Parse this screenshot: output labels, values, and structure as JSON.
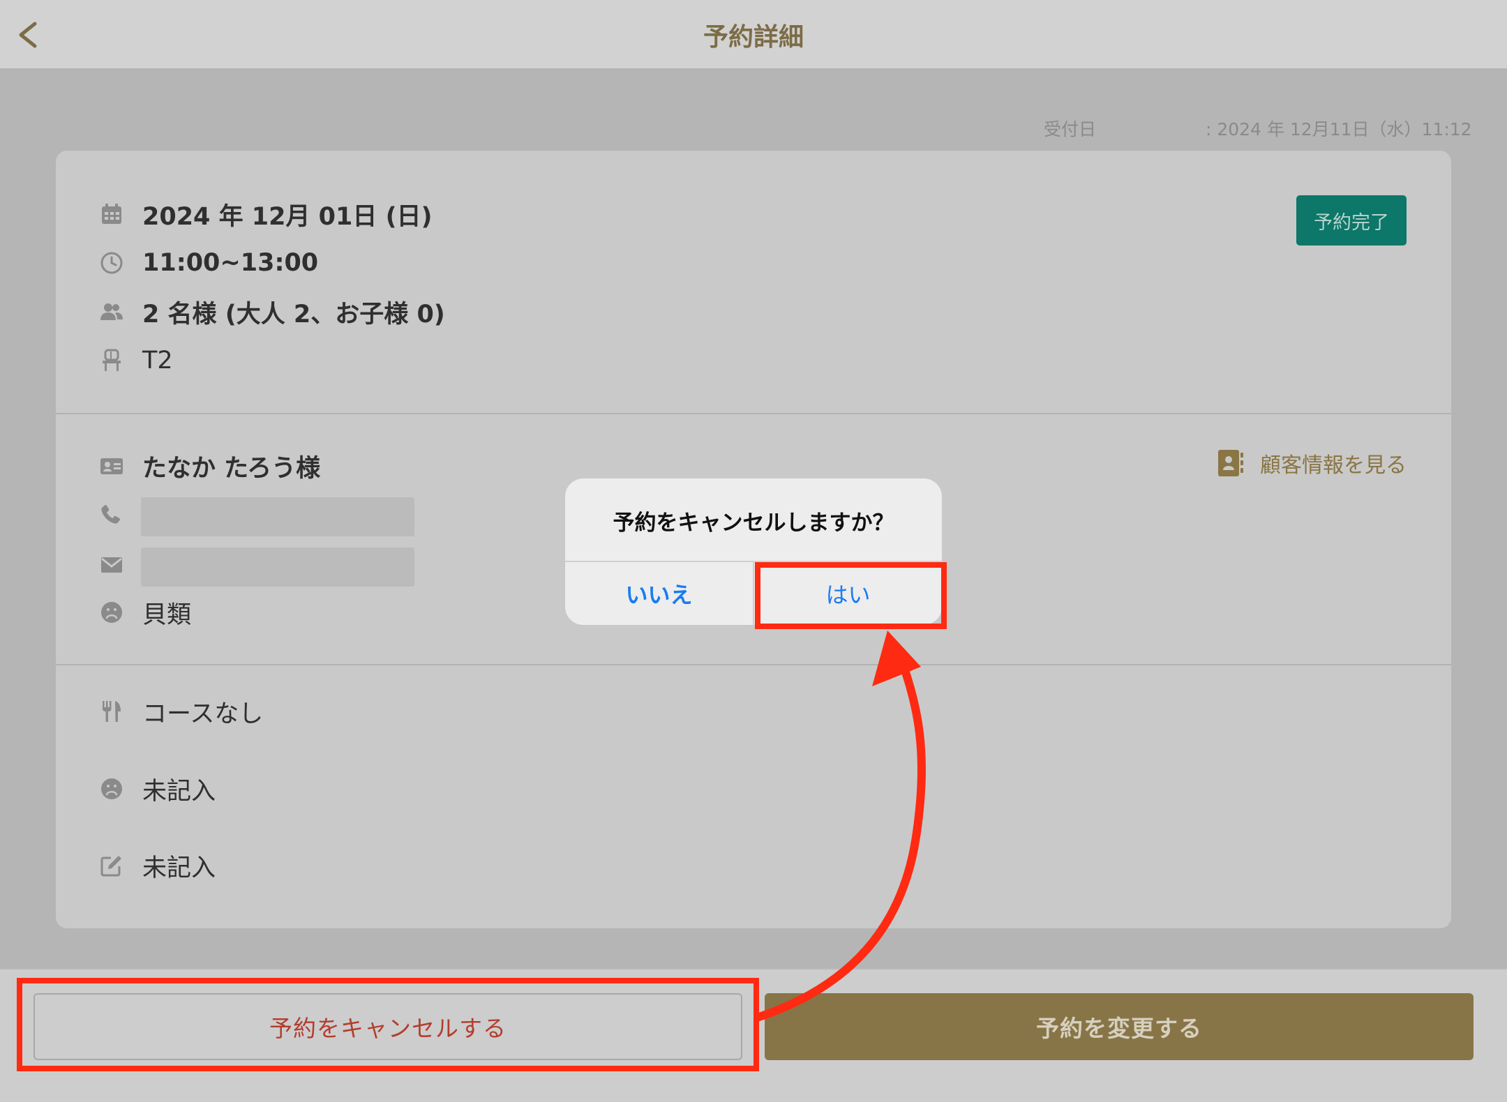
{
  "header": {
    "title": "予約詳細"
  },
  "received": {
    "label": "受付日",
    "value": ": 2024 年 12月11日（水）11:12"
  },
  "reservation": {
    "date": "2024 年 12月 01日 (日)",
    "time": "11:00~13:00",
    "guests": "2 名様 (大人 2、お子様 0)",
    "table": "T2",
    "status": "予約完了"
  },
  "customer": {
    "name": "たなか たろう様",
    "view_link": "顧客情報を見る",
    "allergy": "貝類"
  },
  "details": {
    "course": "コースなし",
    "note1": "未記入",
    "note2": "未記入"
  },
  "footer": {
    "cancel_label": "予約をキャンセルする",
    "change_label": "予約を変更する"
  },
  "dialog": {
    "title": "予約をキャンセルしますか？",
    "no_label": "いいえ",
    "yes_label": "はい"
  },
  "colors": {
    "accent_gold": "#887547",
    "status_green": "#0d7769",
    "ios_blue": "#1a7cf2",
    "annotation_red": "#ff2a12",
    "cancel_text": "#b33d2e"
  },
  "icons": [
    "chevron-left-icon",
    "calendar-icon",
    "clock-icon",
    "people-icon",
    "chair-icon",
    "id-card-icon",
    "phone-icon",
    "mail-icon",
    "sad-face-icon",
    "contact-book-icon",
    "cutlery-icon",
    "edit-icon"
  ]
}
